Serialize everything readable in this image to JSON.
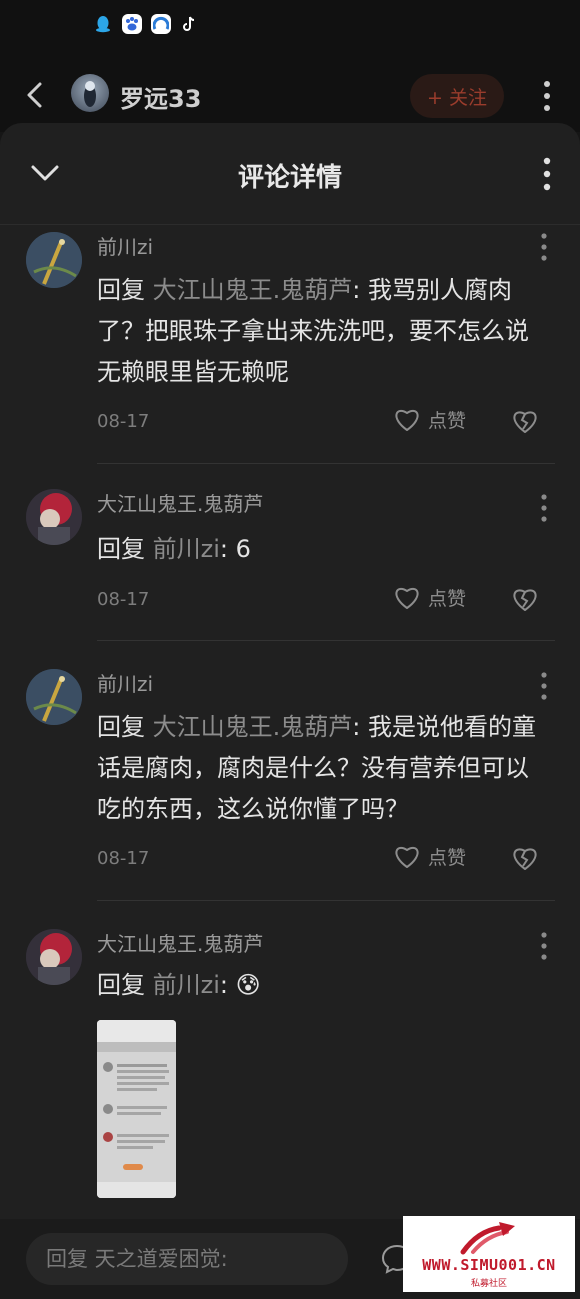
{
  "header": {
    "username": "罗远33",
    "follow_label": "+ 关注"
  },
  "sheet": {
    "title": "评论详情"
  },
  "reply_keyword": "回复",
  "like_label": "点赞",
  "comments": [
    {
      "name": "前川zi",
      "target": "大江山鬼王.鬼葫芦",
      "text": ": 我骂别人腐肉了？把眼珠子拿出来洗洗吧，要不怎么说无赖眼里皆无赖呢",
      "date": "08-17"
    },
    {
      "name": "大江山鬼王.鬼葫芦",
      "target": "前川zi",
      "text": ": 6",
      "date": "08-17"
    },
    {
      "name": "前川zi",
      "target": "大江山鬼王.鬼葫芦",
      "text": ": 我是说他看的童话是腐肉，腐肉是什么？没有营养但可以吃的东西，这么说你懂了吗？",
      "date": "08-17"
    },
    {
      "name": "大江山鬼王.鬼葫芦",
      "target": "前川zi",
      "text": ":",
      "emoji": "😰"
    }
  ],
  "input": {
    "placeholder": "回复 天之道爱困觉:"
  },
  "watermark": {
    "site": "WWW.SIMU001.CN",
    "sub": "私募社区"
  },
  "colors": {
    "background": "#202020",
    "follow_text": "#9a3c2c",
    "watermark": "#c01a2c"
  }
}
